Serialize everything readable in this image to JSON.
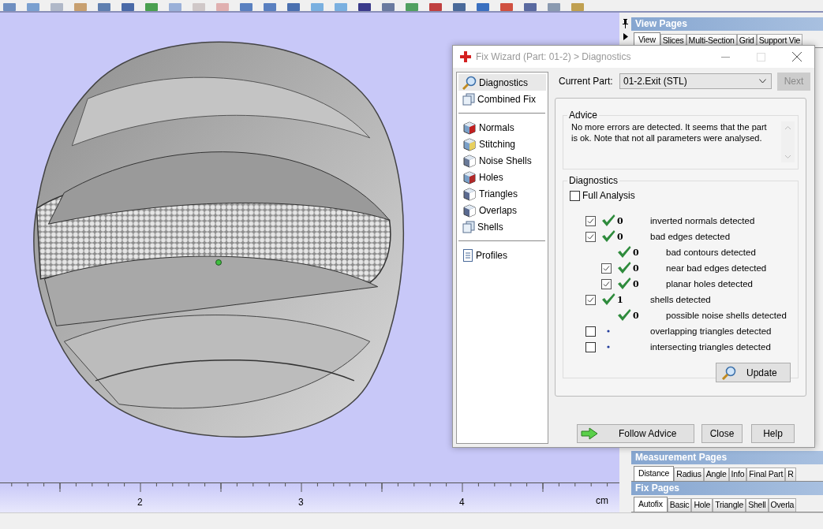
{
  "viewport": {
    "ruler": {
      "labels": [
        "2",
        "3",
        "4"
      ],
      "unit": "cm"
    }
  },
  "view_pages": {
    "title": "View Pages",
    "tabs": [
      {
        "label": "View",
        "selected": true
      },
      {
        "label": "Slices",
        "selected": false
      },
      {
        "label": "Multi-Section",
        "selected": false
      },
      {
        "label": "Grid",
        "selected": false
      },
      {
        "label": "Support Vie",
        "selected": false
      }
    ]
  },
  "measurement_pages": {
    "title": "Measurement Pages",
    "tabs": [
      {
        "label": "Distance",
        "selected": true
      },
      {
        "label": "Radius",
        "selected": false
      },
      {
        "label": "Angle",
        "selected": false
      },
      {
        "label": "Info",
        "selected": false
      },
      {
        "label": "Final Part",
        "selected": false
      },
      {
        "label": "R",
        "selected": false
      }
    ]
  },
  "fix_pages": {
    "title": "Fix Pages",
    "tabs": [
      {
        "label": "Autofix",
        "selected": true
      },
      {
        "label": "Basic",
        "selected": false
      },
      {
        "label": "Hole",
        "selected": false
      },
      {
        "label": "Triangle",
        "selected": false
      },
      {
        "label": "Shell",
        "selected": false
      },
      {
        "label": "Overla",
        "selected": false
      }
    ]
  },
  "dialog": {
    "title": "Fix Wizard (Part: 01-2) > Diagnostics",
    "nav_groups": [
      [
        {
          "label": "Diagnostics",
          "kind": "search",
          "selected": true
        },
        {
          "label": "Combined Fix",
          "kind": "layers",
          "selected": false
        }
      ],
      [
        {
          "label": "Normals",
          "kind": "red-cube",
          "selected": false
        },
        {
          "label": "Stitching",
          "kind": "yellow-cube",
          "selected": false
        },
        {
          "label": "Noise Shells",
          "kind": "dice",
          "selected": false
        },
        {
          "label": "Holes",
          "kind": "hole-cube",
          "selected": false
        },
        {
          "label": "Triangles",
          "kind": "wire-cube",
          "selected": false
        },
        {
          "label": "Overlaps",
          "kind": "wire-cube",
          "selected": false
        },
        {
          "label": "Shells",
          "kind": "layers",
          "selected": false
        }
      ],
      [
        {
          "label": "Profiles",
          "kind": "document",
          "selected": false
        }
      ]
    ],
    "current_part": {
      "label": "Current Part:",
      "value": "01-2.Exit (STL)"
    },
    "next_button": {
      "label": "Next",
      "disabled": true
    },
    "advice": {
      "title": "Advice",
      "text": "No more errors are detected. It seems that the part is ok. Note that not all parameters were analysed."
    },
    "diagnostics": {
      "title": "Diagnostics",
      "full_analysis": {
        "label": "Full Analysis",
        "checked": false
      },
      "rows": [
        {
          "kind": "checkable",
          "checked": true,
          "passed": true,
          "count": "0",
          "label": "inverted normals detected"
        },
        {
          "kind": "checkable",
          "checked": true,
          "passed": true,
          "count": "0",
          "label": "bad edges detected",
          "children": [
            {
              "kind": "plain",
              "passed": true,
              "count": "0",
              "label": "bad contours detected"
            },
            {
              "kind": "checkable",
              "checked": true,
              "passed": true,
              "count": "0",
              "label": "near bad edges detected"
            },
            {
              "kind": "checkable",
              "checked": true,
              "passed": true,
              "count": "0",
              "label": "planar holes detected"
            }
          ]
        },
        {
          "kind": "checkable",
          "checked": true,
          "passed": true,
          "count": "1",
          "label": "shells detected",
          "children": [
            {
              "kind": "plain",
              "passed": true,
              "count": "0",
              "label": "possible noise shells detected"
            }
          ]
        },
        {
          "kind": "checkable",
          "checked": false,
          "passed": false,
          "label": "overlapping triangles detected"
        },
        {
          "kind": "checkable",
          "checked": false,
          "passed": false,
          "label": "intersecting triangles detected"
        }
      ],
      "update_button": "Update"
    },
    "buttons": {
      "follow": "Follow Advice",
      "close": "Close",
      "help": "Help"
    }
  }
}
